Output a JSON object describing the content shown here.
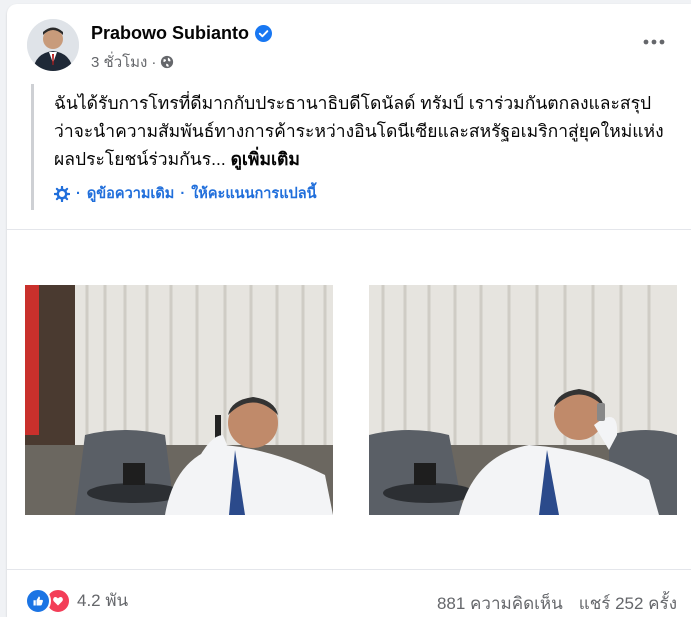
{
  "post": {
    "author": "Prabowo Subianto",
    "time": "3 ชั่วโมง",
    "text": "ฉันได้รับการโทรที่ดีมากกับประธานาธิบดีโดนัลด์ ทรัมป์ เราร่วมกันตกลงและสรุปว่าจะนำความสัมพันธ์ทางการค้าระหว่างอินโดนีเซียและสหรัฐอเมริกาสู่ยุคใหม่แห่งผลประโยชน์ร่วมกันร...",
    "see_more": "ดูเพิ่มเติม",
    "view_original": "ดูข้อความเดิม",
    "separator": "·",
    "rate_translation": "ให้คะแนนการแปลนี้"
  },
  "footer": {
    "reactions_count": "4.2 พัน",
    "comments": "881 ความคิดเห็น",
    "shares": "แชร์ 252 ครั้ง"
  },
  "icons": {
    "verified": "verified-badge-icon",
    "privacy": "globe-icon",
    "more": "more-options-icon",
    "translate": "gear-icon",
    "like": "like-icon",
    "love": "love-icon"
  },
  "colors": {
    "link_blue": "#216fdb",
    "verified_blue": "#1877f2",
    "like_blue": "#1b74e4",
    "love_red": "#f33e58",
    "muted": "#65676b"
  }
}
